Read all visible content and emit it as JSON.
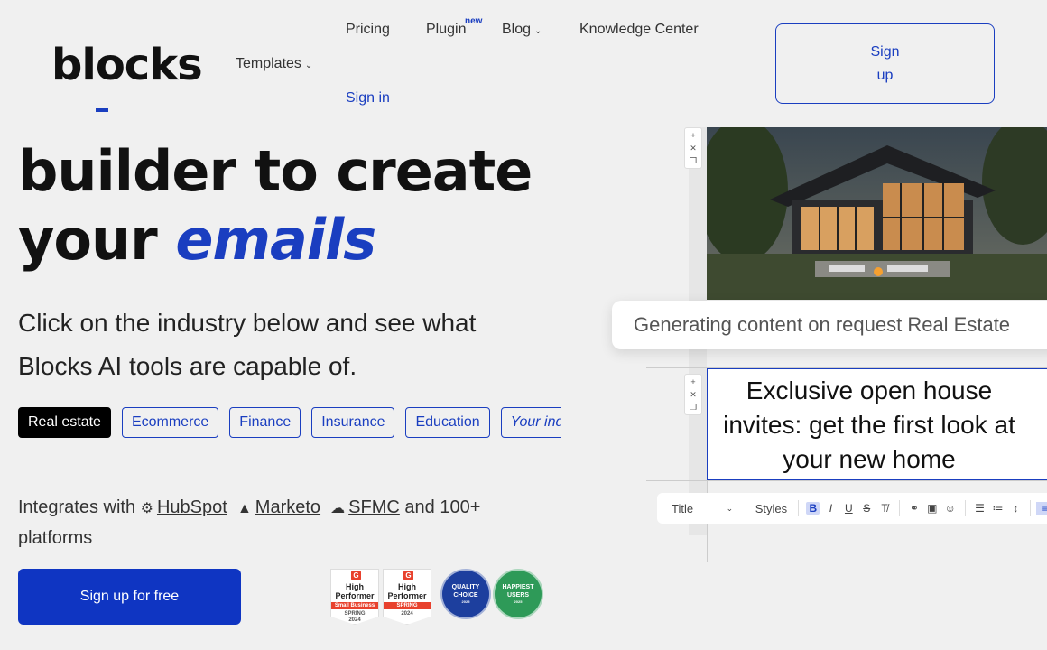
{
  "brand": {
    "logo": "blocks"
  },
  "nav": {
    "templates": "Templates",
    "pricing": "Pricing",
    "plugin": "Plugin",
    "plugin_badge": "new",
    "blog": "Blog",
    "knowledge": "Knowledge Center",
    "signin": "Sign in",
    "signup_line1": "Sign",
    "signup_line2": "up"
  },
  "hero": {
    "line1": "builder to create",
    "line2_plain": "your ",
    "line2_em": "emails",
    "subtitle": "Click on the industry below and see what Blocks AI tools are capable of."
  },
  "industries": [
    "Real estate",
    "Ecommerce",
    "Finance",
    "Insurance",
    "Education",
    "Your industry"
  ],
  "integrations": {
    "prefix": "Integrates with",
    "hubspot": "HubSpot",
    "marketo": "Marketo",
    "sfmc": "SFMC",
    "suffix": "and 100+ platforms"
  },
  "cta": {
    "label": "Sign up for free"
  },
  "badges": {
    "g2_1": {
      "l1": "High",
      "l2": "Performer",
      "band": "Small Business",
      "season": "SPRING",
      "year": "2024"
    },
    "g2_2": {
      "l1": "High",
      "l2": "Performer",
      "band": "SPRING",
      "year": "2024"
    },
    "quality": {
      "l1": "QUALITY",
      "l2": "CHOICE",
      "year": "2025",
      "color": "#1d3f9e"
    },
    "happiest": {
      "l1": "HAPPIEST",
      "l2": "USERS",
      "year": "2025",
      "color": "#2e9a58"
    }
  },
  "editor": {
    "generating": "Generating content on request Real Estate",
    "headline": "Exclusive open house invites: get the first look at your new home",
    "toolbar": {
      "title": "Title",
      "styles": "Styles"
    }
  },
  "colors": {
    "accent": "#1a3ec0",
    "cta": "#0f35c2",
    "background": "#f0f0f0"
  }
}
